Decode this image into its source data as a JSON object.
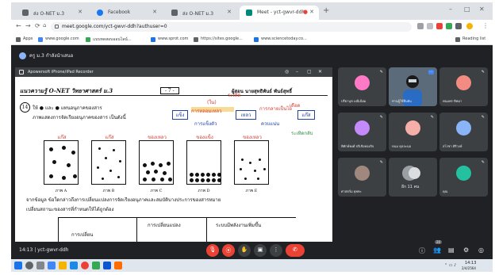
{
  "browser": {
    "tabs": [
      {
        "label": "ส่ง O-NET ม.3",
        "icon_color": "#5f6368",
        "active": false
      },
      {
        "label": "Facebook",
        "icon_color": "#1877f2",
        "active": false
      },
      {
        "label": "ส่ง O-NET ม.3",
        "icon_color": "#5f6368",
        "active": false
      },
      {
        "label": "Meet - yct-gwvr-ddh",
        "icon_color": "#00897b",
        "active": true
      }
    ],
    "new_tab": "+",
    "window_controls": [
      "–",
      "□",
      "✕"
    ],
    "url": "meet.google.com/yct-gwvr-ddh?authuser=0",
    "bookmarks": [
      {
        "label": "Apps",
        "color": "#5f6368"
      },
      {
        "label": "www.google.com",
        "color": "#4285f4"
      },
      {
        "label": "แบบทดสอบออนไลน์...",
        "color": "#34a853"
      },
      {
        "label": "www.sprot.com",
        "color": "#1a73e8"
      },
      {
        "label": "https://sites.google...",
        "color": "#5f6368"
      },
      {
        "label": "www.sciencetoday.co...",
        "color": "#1a73e8"
      }
    ],
    "reading_list": "Reading list"
  },
  "meet": {
    "presenter_label": "ครู ม.3 กำลังนำเสนอ",
    "recorder_title": "Apowersoft iPhone/iPad Recorder",
    "recorder_controls": [
      "◎",
      "–",
      "▢",
      "✕"
    ],
    "document": {
      "header": "แนวความรู้ O-NET วิทยาศาสตร์ ม.3",
      "page": "- 7 -",
      "author": "ผู้สอน นายสุทธิพันธ์ พันธ์สุทธิ์",
      "question_number": "14",
      "question_line1": "ให้ ● และ ● แทนอนุภาคของสาร",
      "question_line2": "ภาพแสดงการจัดเรียงอนุภาคของสาร เป็นดังนี้",
      "images": [
        {
          "label": "ภาพ A",
          "note": "แก๊ส"
        },
        {
          "label": "ภาพ B",
          "note": "แก๊ส"
        },
        {
          "label": "ภาพ C",
          "note": "ของเหลว"
        },
        {
          "label": "ภาพ D",
          "note": "ของแข็ง"
        },
        {
          "label": "ภาพ E",
          "note": "ของเหลว"
        }
      ],
      "paragraph1": "จากข้อมูล ข้อใดกล่าวถึงการเปลี่ยนแปลงการจัดเรียงอนุภาคและสมบัติบางประการของสารหมาย",
      "paragraph2": "เปลี่ยนสถานะของสารที่กำหนดให้ได้ถูกต้อง",
      "table_headers": [
        "การเปลี่ยน",
        "การเปลี่ยนแปลง",
        "ระบบมีพลังงานเพิ่มขึ้น"
      ],
      "annotations": {
        "top_red": "ระเหิด",
        "ice": "(ใน)",
        "solid": "แข็ง",
        "liquid": "เหลว",
        "gas": "แก๊ส",
        "melt": "การหลอมเหลว",
        "freeze": "การแข็งตัว",
        "evap": "การกลายเป็นไอ",
        "cond": "ควบแน่น",
        "boil": "เดือด",
        "deposit": "ระเหิดกลับ"
      }
    },
    "participants": [
      {
        "name": "ปรียานุช มณีเนียม",
        "color": "#ff79c6",
        "mic": "🎙"
      },
      {
        "name": "ท่านผู้ใช้ยืนยัน",
        "color": "#4285f4",
        "mic": "🎙",
        "camera": true
      },
      {
        "name": "พนมพร ทิพมา",
        "color": "#f28b82",
        "mic": "🎙"
      },
      {
        "name": "พิทักษ์พงศ์ ปริเชิงทองกิจ",
        "color": "#c58af9",
        "mic": "🎙"
      },
      {
        "name": "หนม ดุลละนอ",
        "color": "#f6aea9",
        "mic": "🎙"
      },
      {
        "name": "สโรชา ศิริวงษ์",
        "color": "#8ab4f8",
        "mic": "🎙"
      },
      {
        "name": "ศาสตร์ม ยุพทะ",
        "color": "#a1887f",
        "mic": "🎙"
      },
      {
        "name": "อีก 11 คน",
        "color": "#9aa0a6",
        "mic": ""
      },
      {
        "name": "คุณ",
        "color": "#24c1a0",
        "mic": "🎙"
      }
    ],
    "meeting_info": "14:13 | yct-gwvr-ddh",
    "controls": [
      "🎙",
      "⦿",
      "✋",
      "▣",
      "⋮",
      "✆"
    ],
    "right_controls": [
      "ⓘ",
      "👥",
      "▤",
      "⚙",
      "◎"
    ],
    "participant_count": "20"
  },
  "taskbar": {
    "time": "14:13",
    "date": "2/4/2564"
  }
}
